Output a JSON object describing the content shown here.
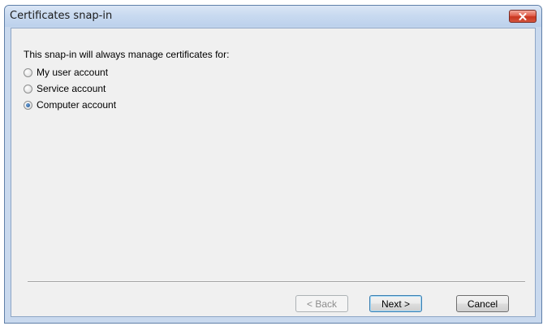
{
  "window": {
    "title": "Certificates snap-in"
  },
  "dialog": {
    "intro": "This snap-in will always manage certificates for:",
    "options": [
      {
        "label": "My user account",
        "checked": false
      },
      {
        "label": "Service account",
        "checked": false
      },
      {
        "label": "Computer account",
        "checked": true
      }
    ]
  },
  "buttons": {
    "back": "< Back",
    "next": "Next >",
    "cancel": "Cancel"
  },
  "colors": {
    "close_button": "#d5553e",
    "titlebar": "#c9daf0",
    "dialog_background": "#f0f0f0"
  }
}
